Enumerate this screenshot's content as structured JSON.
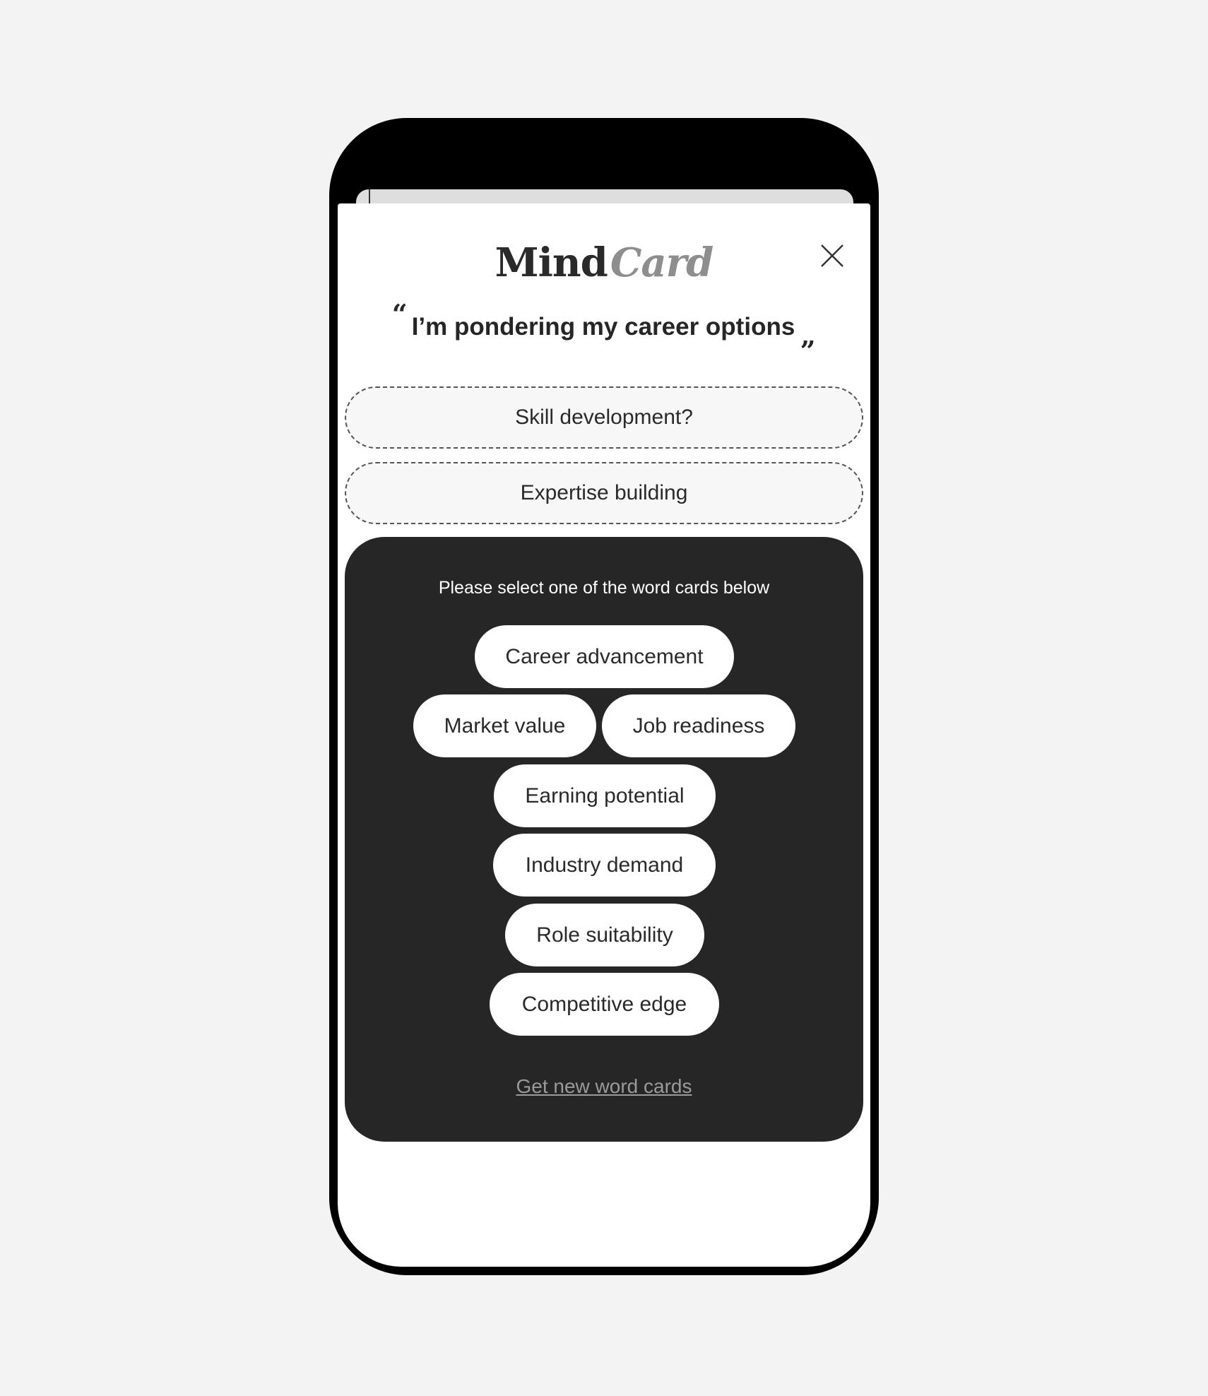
{
  "app": {
    "logo_primary": "Mind",
    "logo_secondary": "Card"
  },
  "icons": {
    "close": "close-icon"
  },
  "prompt": {
    "open_quote": "“",
    "text": "I’m pondering my career options",
    "close_quote": "„"
  },
  "selected_slots": [
    {
      "label": "Skill development?"
    },
    {
      "label": "Expertise building"
    }
  ],
  "word_panel": {
    "instruction": "Please select one of the word cards below",
    "cards": [
      {
        "label": "Career advancement"
      },
      {
        "label": "Market value"
      },
      {
        "label": "Job readiness"
      },
      {
        "label": "Earning potential"
      },
      {
        "label": "Industry demand"
      },
      {
        "label": "Role suitability"
      },
      {
        "label": "Competitive edge"
      }
    ],
    "refresh_label": "Get new word cards"
  },
  "colors": {
    "page_background": "#f3f3f3",
    "phone_frame": "#000000",
    "panel_background": "#262626",
    "logo_secondary": "#8e8e8e",
    "link": "#9a9a9a"
  }
}
